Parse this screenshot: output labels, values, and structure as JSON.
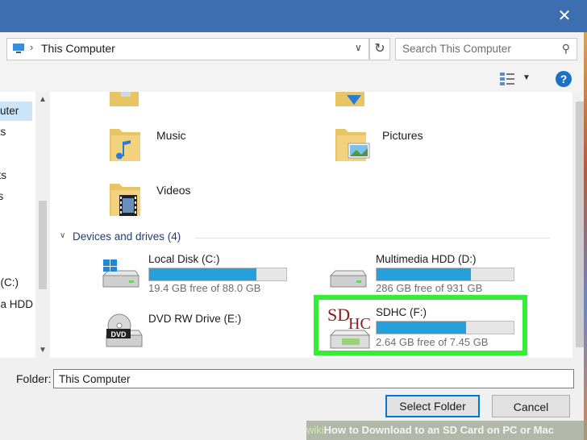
{
  "address": {
    "crumb": "This Computer"
  },
  "search": {
    "placeholder": "Search This Computer"
  },
  "nav_pane": {
    "items": [
      "uter",
      "cts",
      "nts",
      "ds",
      "k (C:)",
      "dia HDD",
      ")"
    ]
  },
  "folders": [
    {
      "label": "Music"
    },
    {
      "label": "Pictures"
    },
    {
      "label": "Videos"
    }
  ],
  "devices_group": {
    "label": "Devices and drives (4)"
  },
  "drives": [
    {
      "name": "Local Disk (C:)",
      "free_text": "19.4 GB free of 88.0 GB",
      "used_fraction": 0.78
    },
    {
      "name": "Multimedia HDD (D:)",
      "free_text": "286 GB free of 931 GB",
      "used_fraction": 0.69
    },
    {
      "name": "DVD RW Drive (E:)",
      "free_text": "",
      "used_fraction": null
    },
    {
      "name": "SDHC (F:)",
      "free_text": "2.64 GB free of 7.45 GB",
      "used_fraction": 0.65
    }
  ],
  "sd_logo": {
    "sd": "SD",
    "hc": "HC"
  },
  "dvd_logo": "DVD",
  "folder_field": {
    "label": "Folder:",
    "value": "This Computer"
  },
  "buttons": {
    "select": "Select Folder",
    "cancel": "Cancel"
  },
  "watermark": {
    "wiki": "wiki",
    "text": "How to Download to an SD Card on PC or Mac"
  },
  "colors": {
    "titlebar": "#3d6eb0",
    "progress": "#26a0da",
    "highlight": "#33ee33",
    "help": "#1b72c4"
  }
}
